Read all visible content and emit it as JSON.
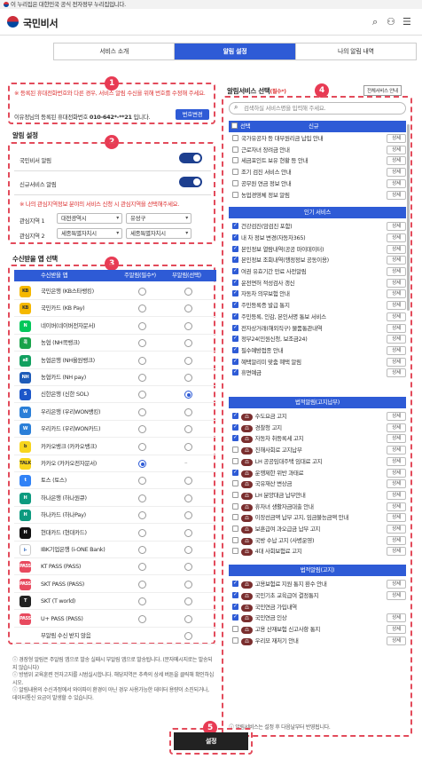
{
  "gov_banner": "이 누리집은 대한민국 공식 전자정부 누리집입니다.",
  "header": {
    "brand": "국민비서"
  },
  "tabs": [
    {
      "label": "서비스 소개"
    },
    {
      "label": "알림 설정"
    },
    {
      "label": "나의 알림 내역"
    }
  ],
  "callouts": [
    "1",
    "2",
    "3",
    "4",
    "5"
  ],
  "phone": {
    "notice": "※ 등록된 휴대전화번호와 다른 경우, 서비스 알림 수신을 위해 번호를 수정해 주세요.",
    "label": "이유정님의 등록된 휴대전화번호",
    "number": "010-642*-**21",
    "suffix": "입니다.",
    "change_button": "번호변경"
  },
  "alarm": {
    "title": "알림 설정",
    "national": "국민비서 알림",
    "new_service": "신규서비스 알림",
    "interest_notice": "※ 나의 관심지역정보 분야의 서비스 신청 시 관심지역을 선택해주세요.",
    "region1_label": "관심지역 1",
    "region1_a": "대전광역시",
    "region1_b": "유성구",
    "region2_label": "관심지역 2",
    "region2_a": "세종특별자치시",
    "region2_b": "세종특별자치시"
  },
  "receive": {
    "title": "수신받을 앱 선택",
    "col_app": "수신받을 앱",
    "col_primary": "주알림(필수*)",
    "col_secondary": "부알림(선택)",
    "apps": [
      {
        "name": "국민은행 (KB스타뱅킹)",
        "icon": "KB",
        "color": "#f5b800",
        "p": false,
        "s": "radio"
      },
      {
        "name": "국민카드 (KB Pay)",
        "icon": "KB",
        "color": "#f5b800",
        "p": false,
        "s": "radio"
      },
      {
        "name": "네이버(네이버전자문서)",
        "icon": "N",
        "color": "#03c75a",
        "p": false,
        "s": "radio"
      },
      {
        "name": "농협 (NH콕뱅크)",
        "icon": "콕",
        "color": "#1aa34a",
        "p": false,
        "s": "radio"
      },
      {
        "name": "농협은행 (NH올원뱅크)",
        "icon": "all one",
        "color": "#12a05f",
        "p": false,
        "s": "radio"
      },
      {
        "name": "농협카드 (NH pay)",
        "icon": "NH pay",
        "color": "#1e5bb8",
        "p": false,
        "s": "radio"
      },
      {
        "name": "신한은행 (신한 SOL)",
        "icon": "S",
        "color": "#1d57c9",
        "p": false,
        "s": "on"
      },
      {
        "name": "우리은행 (우리WON뱅킹)",
        "icon": "W",
        "color": "#2b7fd8",
        "p": false,
        "s": "radio"
      },
      {
        "name": "우리카드 (우리WON카드)",
        "icon": "W",
        "color": "#2b7fd8",
        "p": false,
        "s": "radio"
      },
      {
        "name": "카카오뱅크 (카카오뱅크)",
        "icon": "b",
        "color": "#f7d51d",
        "p": false,
        "s": "radio"
      },
      {
        "name": "카카오 (카카오전자문서)",
        "icon": "TALK",
        "color": "#f7d51d",
        "p": true,
        "s": "dash"
      },
      {
        "name": "토스 (토스)",
        "icon": "t",
        "color": "#3182f6",
        "p": false,
        "s": "radio"
      },
      {
        "name": "하나은행 (하나원큐)",
        "icon": "H",
        "color": "#0d9a7f",
        "p": false,
        "s": "radio"
      },
      {
        "name": "하나카드 (하나Pay)",
        "icon": "H",
        "color": "#0d9a7f",
        "p": false,
        "s": "radio"
      },
      {
        "name": "현대카드 (현대카드)",
        "icon": "H",
        "color": "#111111",
        "p": false,
        "s": "radio"
      },
      {
        "name": "IBK기업은행 (i-ONE Bank)",
        "icon": "i-ONE",
        "color": "#ffffff",
        "p": false,
        "s": "radio"
      },
      {
        "name": "KT PASS (PASS)",
        "icon": "PASS",
        "color": "#e84a5f",
        "p": false,
        "s": "radio"
      },
      {
        "name": "SKT PASS (PASS)",
        "icon": "PASS",
        "color": "#e84a5f",
        "p": false,
        "s": "radio"
      },
      {
        "name": "SKT (T world)",
        "icon": "T",
        "color": "#222222",
        "p": false,
        "s": "radio"
      },
      {
        "name": "U+ PASS (PASS)",
        "icon": "PASS",
        "color": "#e84a5f",
        "p": false,
        "s": "radio"
      },
      {
        "name": "부알림 수신 받지 않음",
        "icon": "",
        "color": "",
        "p": null,
        "s": "radio"
      }
    ]
  },
  "footer_notes": [
    "ⓘ 경장형 알림은 주알림 앱으로 발송 실패시 부알림 앱으로 발송됩니다. (문자메시지로는 발송되지 않습니다)",
    "ⓘ 방범위 교육훈련 전자고지를 시범실시합니다. 해당지역은 추측의 상세 버튼을 클릭해 확인하십시오.",
    "ⓘ 알림내용의 수신과정에서 와이파이 환경이 아닌 경우 사용가능한 데이터 용량이 소진되거나,",
    "데이터통신 요금이 발생할 수 있습니다."
  ],
  "services": {
    "title": "알림서비스 선택",
    "title_req": "(필수*)",
    "all_button": "전체서비스 안내",
    "search_placeholder": "검색하실 서비스명을 입력해 주세요.",
    "col_select": "선택",
    "col_new": "신규",
    "detail": "상세",
    "group_new": [
      {
        "t": "국가유공자 등 대부원리금 납입 안내",
        "c": false,
        "d": true
      },
      {
        "t": "근로자녀 장려금 안내",
        "c": false,
        "d": true
      },
      {
        "t": "세금포인트 보유 현황 등 안내",
        "c": false,
        "d": true
      },
      {
        "t": "조기 검진 서비스 안내",
        "c": false,
        "d": true
      },
      {
        "t": "공무원 연금 정보 안내",
        "c": false,
        "d": true
      },
      {
        "t": "농업경영체 정보 알림",
        "c": false,
        "d": true
      }
    ],
    "popular_header": "인기 서비스",
    "popular": [
      {
        "t": "건강검진(암검진 포함)",
        "c": true,
        "d": true
      },
      {
        "t": "내 차 정보 변경(자동차365)",
        "c": true,
        "d": true
      },
      {
        "t": "본인정보 열람내역(공공 마이데이터)",
        "c": true,
        "d": true
      },
      {
        "t": "본인정보 조회내역(행정정보 공동이용)",
        "c": true,
        "d": true
      },
      {
        "t": "여권 유효기간 만료 사전알림",
        "c": true,
        "d": true
      },
      {
        "t": "운전면허 적성검사 갱신",
        "c": true,
        "d": true
      },
      {
        "t": "자동차 의무보험 안내",
        "c": true,
        "d": true
      },
      {
        "t": "주민등록증 발급 통지",
        "c": true,
        "d": true
      },
      {
        "t": "주민등록, 인감, 본인서명 통보 서비스",
        "c": true,
        "d": true
      },
      {
        "t": "전자상거래(해외직구) 물품통관내역",
        "c": true,
        "d": true
      },
      {
        "t": "정부24(민원신청, 보조금24)",
        "c": true,
        "d": true
      },
      {
        "t": "필수예방접종 안내",
        "c": true,
        "d": true
      },
      {
        "t": "혜택알리미 맞춤 혜택 알림",
        "c": true,
        "d": true
      },
      {
        "t": "휴면예금",
        "c": true,
        "d": true
      }
    ],
    "legal_header": "법적알림(고지납부)",
    "legal": [
      {
        "t": "수도요금 고지",
        "c": true,
        "d": true
      },
      {
        "t": "경찰청 고지",
        "c": true,
        "d": true
      },
      {
        "t": "자동차 취등록세 고지",
        "c": true,
        "d": true
      },
      {
        "t": "진해사회로 고지납부",
        "c": false,
        "d": true
      },
      {
        "t": "LH 공공임대주택 임대료 고지",
        "c": false,
        "d": true
      },
      {
        "t": "운행제한 위반 과태료",
        "c": true,
        "d": true
      },
      {
        "t": "국유재산 변상금",
        "c": false,
        "d": true
      },
      {
        "t": "LH 분양대금 납부안내",
        "c": false,
        "d": true
      },
      {
        "t": "휴자녀 생활자금대출 안내",
        "c": false,
        "d": true
      },
      {
        "t": "이장선금액 납부 고지, 임금불능금액 안내",
        "c": false,
        "d": true
      },
      {
        "t": "보훈급여 과오급금 납부 고지",
        "c": false,
        "d": true
      },
      {
        "t": "국방 수납 고지 (사병운영)",
        "c": false,
        "d": true
      },
      {
        "t": "4대 사회보험료 고지",
        "c": false,
        "d": true
      }
    ],
    "legal2_header": "법적알림(고지)",
    "legal2": [
      {
        "t": "고용보험료 지원 통지 환수 안내",
        "c": true,
        "d": true
      },
      {
        "t": "국민기초 교육급여 결정통지",
        "c": true,
        "d": true
      },
      {
        "t": "국민연금 가입내역",
        "c": true,
        "d": false
      },
      {
        "t": "국민연금 인상",
        "c": true,
        "d": true
      },
      {
        "t": "고용 산재보험 신고사항 통지",
        "c": false,
        "d": true
      },
      {
        "t": "우리모 재처기 안내",
        "c": false,
        "d": true
      }
    ],
    "footer": "ⓘ 알림서비스는 설정 후 다음날부터 반영됩니다."
  },
  "submit": "설정"
}
